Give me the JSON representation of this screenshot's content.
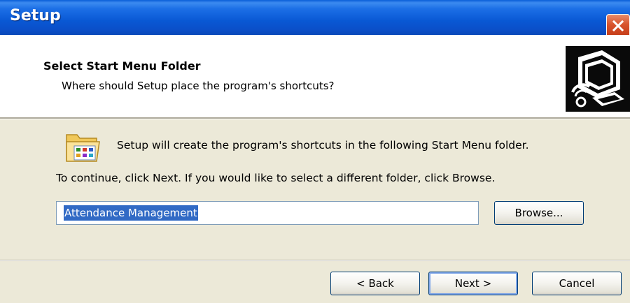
{
  "window": {
    "title": "Setup"
  },
  "header": {
    "title": "Select Start Menu Folder",
    "subtitle": "Where should Setup place the program's shortcuts?"
  },
  "body": {
    "info_text": "Setup will create the program's shortcuts in the following Start Menu folder.",
    "instruction_text": "To continue, click Next. If you would like to select a different folder, click Browse."
  },
  "folder_field": {
    "value": "Attendance Management",
    "selected": true
  },
  "buttons": {
    "browse": "Browse...",
    "back": "< Back",
    "next": "Next >",
    "cancel": "Cancel"
  },
  "icons": {
    "close": "close-icon",
    "header": "computer-setup-icon",
    "folder": "start-menu-folder-icon"
  },
  "colors": {
    "titlebar": "#0958d4",
    "close_button": "#d8532c",
    "selection": "#316ac5",
    "dialog_bg": "#ece9d8"
  }
}
